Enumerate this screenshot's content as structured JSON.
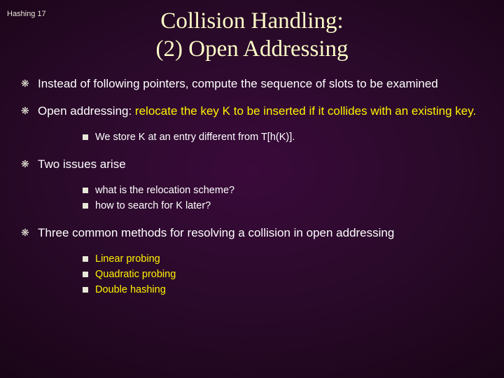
{
  "pageLabel": "Hashing 17",
  "title": {
    "line1": "Collision Handling:",
    "line2": "(2) Open Addressing"
  },
  "b1": {
    "marker": "❋",
    "text": "Instead of following pointers, compute the sequence of slots to be examined"
  },
  "b2": {
    "marker": "❋",
    "pre": "Open addressing: ",
    "hl": "relocate the key K to be inserted if it collides with an existing key.",
    "subs": [
      {
        "text": "We store K at an entry different from T[h(K)]."
      }
    ]
  },
  "b3": {
    "marker": "❋",
    "text": "Two issues arise",
    "subs": [
      {
        "text": "what is the relocation scheme?"
      },
      {
        "text": "how to search for K later?"
      }
    ]
  },
  "b4": {
    "marker": "❋",
    "text": "Three common methods for resolving a collision in open addressing",
    "subs": [
      {
        "text": "Linear probing"
      },
      {
        "text": "Quadratic probing"
      },
      {
        "text": "Double hashing"
      }
    ]
  }
}
